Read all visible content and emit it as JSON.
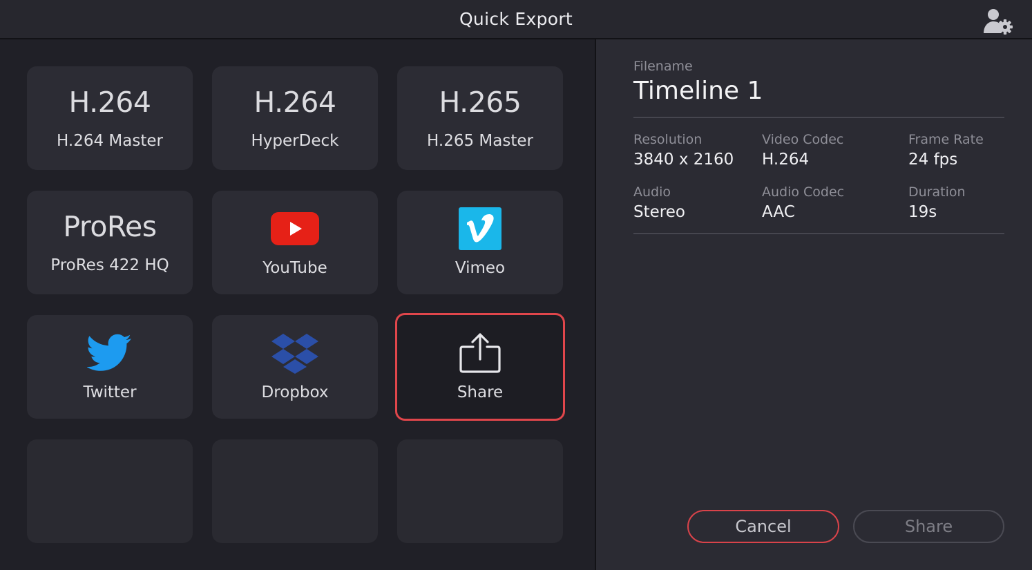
{
  "window": {
    "title": "Quick Export"
  },
  "presets": [
    {
      "big": "H.264",
      "label": "H.264 Master"
    },
    {
      "big": "H.264",
      "label": "HyperDeck"
    },
    {
      "big": "H.265",
      "label": "H.265 Master"
    },
    {
      "big": "ProRes",
      "label": "ProRes 422 HQ"
    },
    {
      "label": "YouTube",
      "icon": "youtube-icon"
    },
    {
      "label": "Vimeo",
      "icon": "vimeo-icon"
    },
    {
      "label": "Twitter",
      "icon": "twitter-icon"
    },
    {
      "label": "Dropbox",
      "icon": "dropbox-icon"
    },
    {
      "label": "Share",
      "icon": "share-icon",
      "selected": true
    }
  ],
  "details": {
    "filename_label": "Filename",
    "filename": "Timeline 1",
    "resolution_label": "Resolution",
    "resolution": "3840 x 2160",
    "video_codec_label": "Video Codec",
    "video_codec": "H.264",
    "frame_rate_label": "Frame Rate",
    "frame_rate": "24 fps",
    "audio_label": "Audio",
    "audio": "Stereo",
    "audio_codec_label": "Audio Codec",
    "audio_codec": "AAC",
    "duration_label": "Duration",
    "duration": "19s"
  },
  "actions": {
    "cancel_label": "Cancel",
    "share_label": "Share"
  },
  "colors": {
    "accent_red": "#e0464b",
    "youtube_red": "#e62117",
    "vimeo_blue": "#1ab7ea",
    "twitter_blue": "#1d9bf0",
    "dropbox_blue": "#2b4fa8"
  }
}
